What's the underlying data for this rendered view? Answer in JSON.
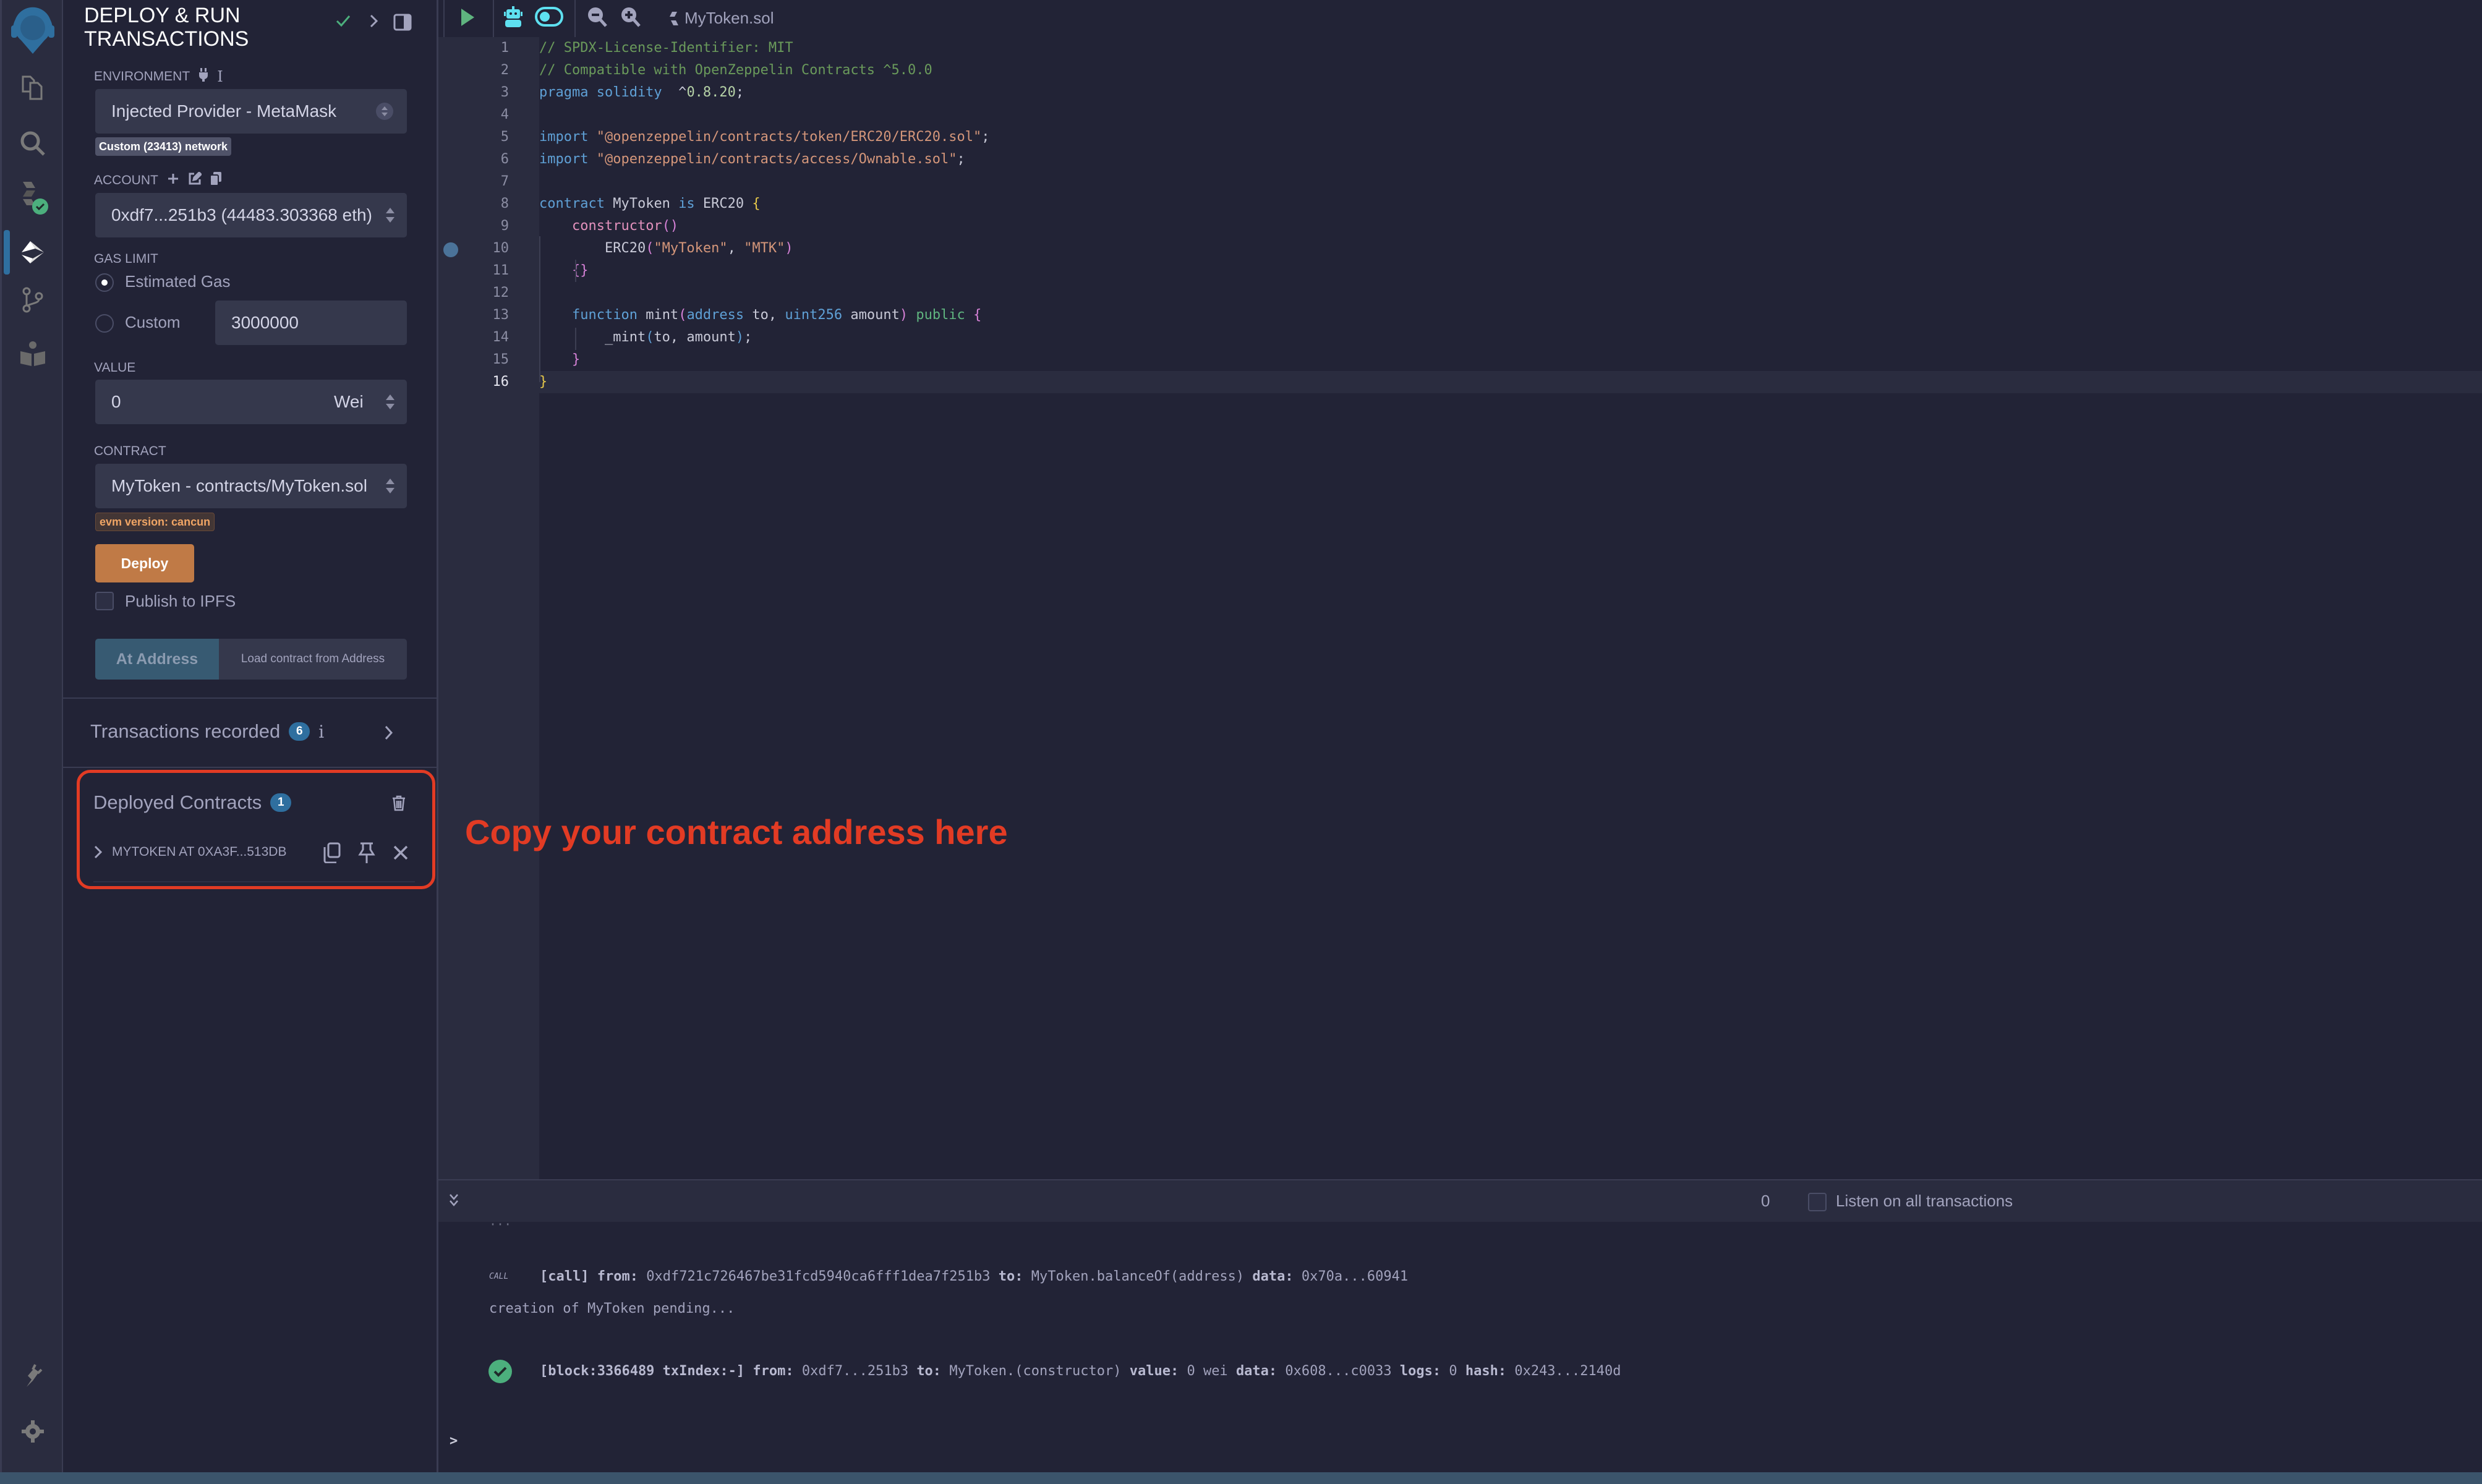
{
  "sidebar": {
    "title_line1": "DEPLOY & RUN",
    "title_line2": "TRANSACTIONS",
    "environment": {
      "label": "ENVIRONMENT",
      "value": "Injected Provider - MetaMask",
      "network_badge": "Custom (23413) network"
    },
    "account": {
      "label": "ACCOUNT",
      "value": "0xdf7...251b3 (44483.303368 eth)"
    },
    "gas_limit": {
      "label": "GAS LIMIT",
      "estimated_label": "Estimated Gas",
      "custom_label": "Custom",
      "custom_value": "3000000",
      "selected": "Estimated Gas"
    },
    "value": {
      "label": "VALUE",
      "amount": "0",
      "unit": "Wei"
    },
    "contract": {
      "label": "CONTRACT",
      "value": "MyToken - contracts/MyToken.sol",
      "evm_badge": "evm version: cancun"
    },
    "deploy_label": "Deploy",
    "publish_ipfs_label": "Publish to IPFS",
    "at_address_label": "At Address",
    "load_address_placeholder": "Load contract from Address",
    "transactions_recorded": {
      "label": "Transactions recorded",
      "count": "6"
    },
    "deployed_contracts": {
      "label": "Deployed Contracts",
      "count": "1",
      "items": [
        {
          "label": "MYTOKEN AT 0XA3F...513DB"
        }
      ]
    }
  },
  "iconbar": {
    "items": [
      "file-explorer",
      "search",
      "solidity-compiler",
      "deploy-run",
      "git",
      "learneth"
    ],
    "bottom": [
      "plugin-manager",
      "settings"
    ]
  },
  "editor": {
    "file_name": "MyToken.sol",
    "current_line": 16,
    "breakpoint_line": 10
  },
  "annotation": {
    "text": "Copy your contract address here",
    "color": "#e23b24"
  },
  "terminal": {
    "pending_count": "0",
    "listen_label": "Listen on all transactions",
    "call_tag": "CALL",
    "call_line": {
      "tag": "[call]",
      "from_label": "from:",
      "from": "0xdf721c726467be31fcd5940ca6fff1dea7f251b3",
      "to_label": "to:",
      "to": "MyToken.balanceOf(address)",
      "data_label": "data:",
      "data": "0x70a...60941"
    },
    "pending_line": "creation of MyToken pending...",
    "tx_line": {
      "block": "[block:3366489 txIndex:-]",
      "from_label": "from:",
      "from": "0xdf7...251b3",
      "to_label": "to:",
      "to": "MyToken.(constructor)",
      "value_label": "value:",
      "value": "0 wei",
      "data_label": "data:",
      "data": "0x608...c0033",
      "logs_label": "logs:",
      "logs": "0",
      "hash_label": "hash:",
      "hash": "0x243...2140d"
    },
    "prompt": ">"
  }
}
